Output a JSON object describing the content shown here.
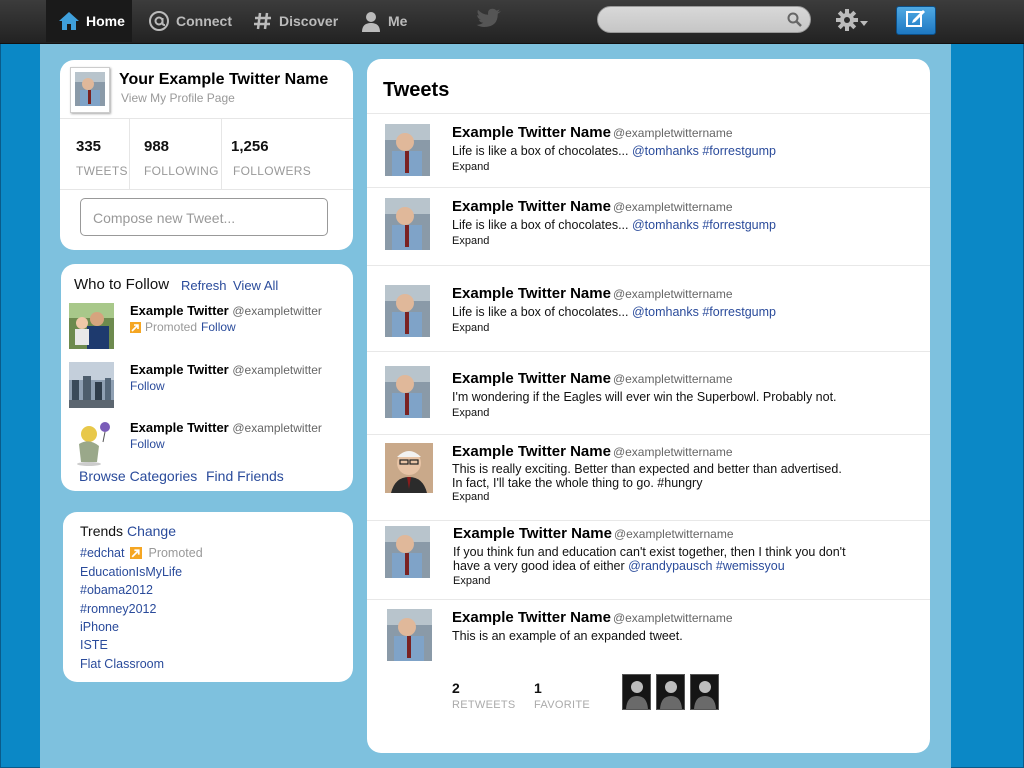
{
  "nav": {
    "items": [
      {
        "label": "Home",
        "icon": "home-icon",
        "active": true
      },
      {
        "label": "Connect",
        "icon": "at-icon"
      },
      {
        "label": "Discover",
        "icon": "hash-icon"
      },
      {
        "label": "Me",
        "icon": "person-icon"
      }
    ],
    "search_placeholder": "",
    "colors": {
      "bar": "#2b2b2b",
      "compose": "#2a8ad4",
      "page_bg": "#0b88c6",
      "band": "#7ec1de"
    }
  },
  "profile": {
    "name": "Your Example Twitter Name",
    "link": "View My Profile Page",
    "stats": [
      {
        "num": "335",
        "label": "TWEETS"
      },
      {
        "num": "988",
        "label": "FOLLOWING"
      },
      {
        "num": "1,256",
        "label": "FOLLOWERS"
      }
    ],
    "compose_placeholder": "Compose new Tweet..."
  },
  "who_to_follow": {
    "title": "Who to Follow",
    "refresh": "Refresh",
    "view_all": "View All",
    "items": [
      {
        "name": "Example Twitter",
        "handle": "@exampletwitter",
        "promoted": "Promoted",
        "follow": "Follow"
      },
      {
        "name": "Example Twitter",
        "handle": "@exampletwitter",
        "follow": "Follow"
      },
      {
        "name": "Example Twitter",
        "handle": "@exampletwitter",
        "follow": "Follow"
      }
    ],
    "browse": "Browse Categories",
    "find_friends": "Find Friends"
  },
  "trends": {
    "title": "Trends",
    "change": "Change",
    "items": [
      {
        "tag": "#edchat",
        "promoted": "Promoted"
      },
      {
        "tag": "EducationIsMyLife"
      },
      {
        "tag": "#obama2012"
      },
      {
        "tag": "#romney2012"
      },
      {
        "tag": "iPhone"
      },
      {
        "tag": "ISTE"
      },
      {
        "tag": "Flat Classroom"
      }
    ]
  },
  "tweets": {
    "title": "Tweets",
    "expand": "Expand",
    "items": [
      {
        "name": "Example Twitter Name",
        "handle": "@exampletwittername",
        "text": "Life is like a box of chocolates... ",
        "mention": "@tomhanks",
        "hashtag": "#forrestgump"
      },
      {
        "name": "Example Twitter Name",
        "handle": "@exampletwittername",
        "text": "Life is like a box of chocolates... ",
        "mention": "@tomhanks",
        "hashtag": "#forrestgump"
      },
      {
        "name": "Example Twitter Name",
        "handle": "@exampletwittername",
        "text": "Life is like a box of chocolates... ",
        "mention": "@tomhanks",
        "hashtag": "#forrestgump"
      },
      {
        "name": "Example Twitter Name",
        "handle": "@exampletwittername",
        "text": "I'm wondering if the Eagles will ever win the Superbowl. Probably not."
      },
      {
        "name": "Example Twitter Name",
        "handle": "@exampletwittername",
        "text": "This is really exciting. Better than expected and better than advertised.\nIn fact, I'll take the whole thing to go. #hungry"
      },
      {
        "name": "Example Twitter Name",
        "handle": "@exampletwittername",
        "text": "If you think fun and education can't exist together, then I think you don't\nhave a very good idea of either ",
        "mention": "@randypausch",
        "hashtag": "#wemissyou"
      },
      {
        "name": "Example Twitter Name",
        "handle": "@exampletwittername",
        "text": "This is an example of an expanded tweet."
      }
    ],
    "expanded": {
      "retweets": "2",
      "retweets_label": "RETWEETS",
      "favorites": "1",
      "favorites_label": "FAVORITE"
    }
  }
}
